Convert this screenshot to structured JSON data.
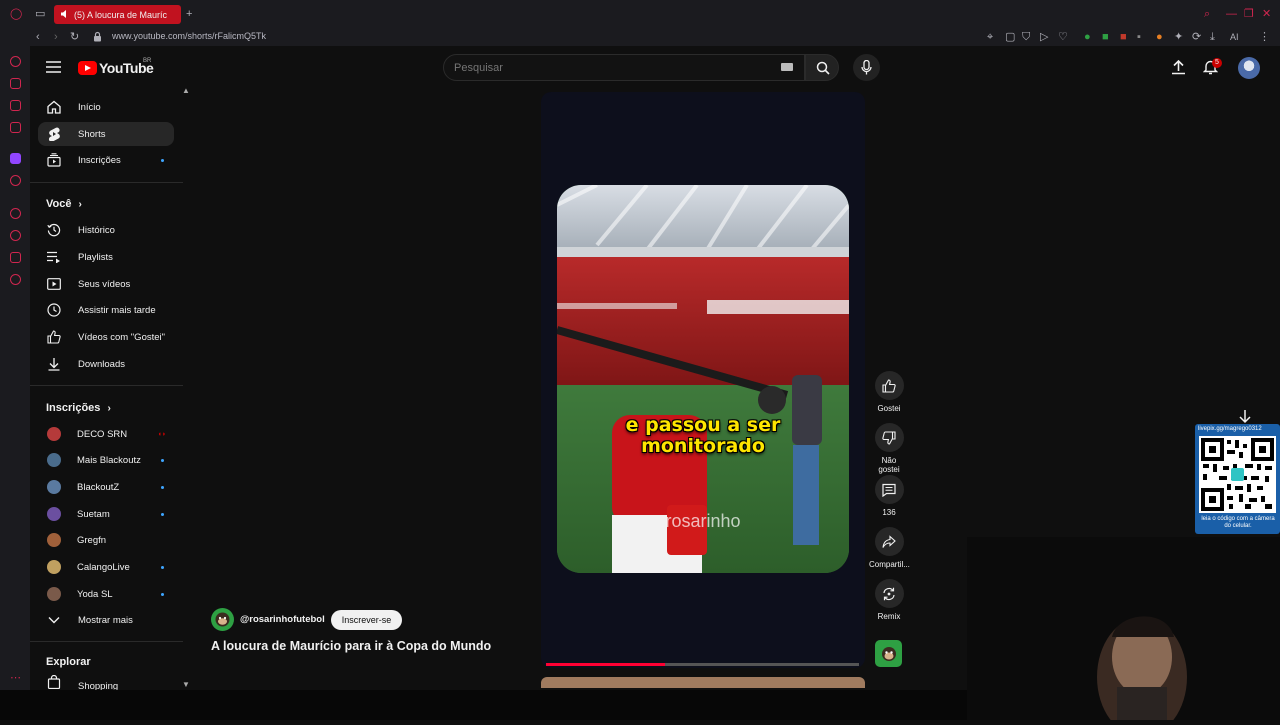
{
  "browser": {
    "tab_title": "(5) A loucura de Mauríc",
    "url": "www.youtube.com/shorts/rFalicmQ5Tk",
    "new_tab": "+",
    "ai_label": "AI"
  },
  "header": {
    "logo_text": "YouTube",
    "region": "BR",
    "search_placeholder": "Pesquisar",
    "notifications_count": "5"
  },
  "sidebar": {
    "main": [
      {
        "label": "Início",
        "icon": "home-icon"
      },
      {
        "label": "Shorts",
        "icon": "shorts-icon",
        "active": true
      },
      {
        "label": "Inscrições",
        "icon": "subscriptions-icon"
      }
    ],
    "you_title": "Você",
    "you": [
      {
        "label": "Histórico",
        "icon": "history-icon"
      },
      {
        "label": "Playlists",
        "icon": "playlists-icon"
      },
      {
        "label": "Seus vídeos",
        "icon": "your-videos-icon"
      },
      {
        "label": "Assistir mais tarde",
        "icon": "watch-later-icon"
      },
      {
        "label": "Vídeos com \"Gostei\"",
        "icon": "like-icon"
      },
      {
        "label": "Downloads",
        "icon": "download-icon"
      }
    ],
    "subs_title": "Inscrições",
    "subs": [
      {
        "label": "DECO SRN",
        "color": "#b53a3a",
        "live": true
      },
      {
        "label": "Mais Blackoutz",
        "color": "#4a6c8c"
      },
      {
        "label": "BlackoutZ",
        "color": "#5a7aa0"
      },
      {
        "label": "Suetam",
        "color": "#6b4fa0"
      },
      {
        "label": "Gregfn",
        "color": "#a0603a"
      },
      {
        "label": "CalangoLive",
        "color": "#c0a060"
      },
      {
        "label": "Yoda SL",
        "color": "#7a5a4a"
      }
    ],
    "show_more": "Mostrar mais",
    "explore_title": "Explorar",
    "shopping": "Shopping"
  },
  "video": {
    "caption_line1": "e passou a ser",
    "caption_line2": "monitorado",
    "watermark": "rosarinho",
    "progress": 0.38
  },
  "actions": {
    "like": "Gostei",
    "dislike": "Não gostei",
    "comments": "136",
    "share": "Compartil...",
    "remix": "Remix"
  },
  "owner": {
    "handle": "@rosarinhofutebol",
    "subscribe": "Inscrever-se",
    "title": "A loucura de Maurício para ir à Copa do Mundo"
  },
  "overlay": {
    "qr_caption_top": "livepix.gg/magrego0312",
    "qr_caption_bottom": "leia o código com a câmera do celular."
  },
  "colors": {
    "accent": "#ff0000",
    "tab_active": "#c1121f",
    "link_blue": "#3ea6ff"
  }
}
